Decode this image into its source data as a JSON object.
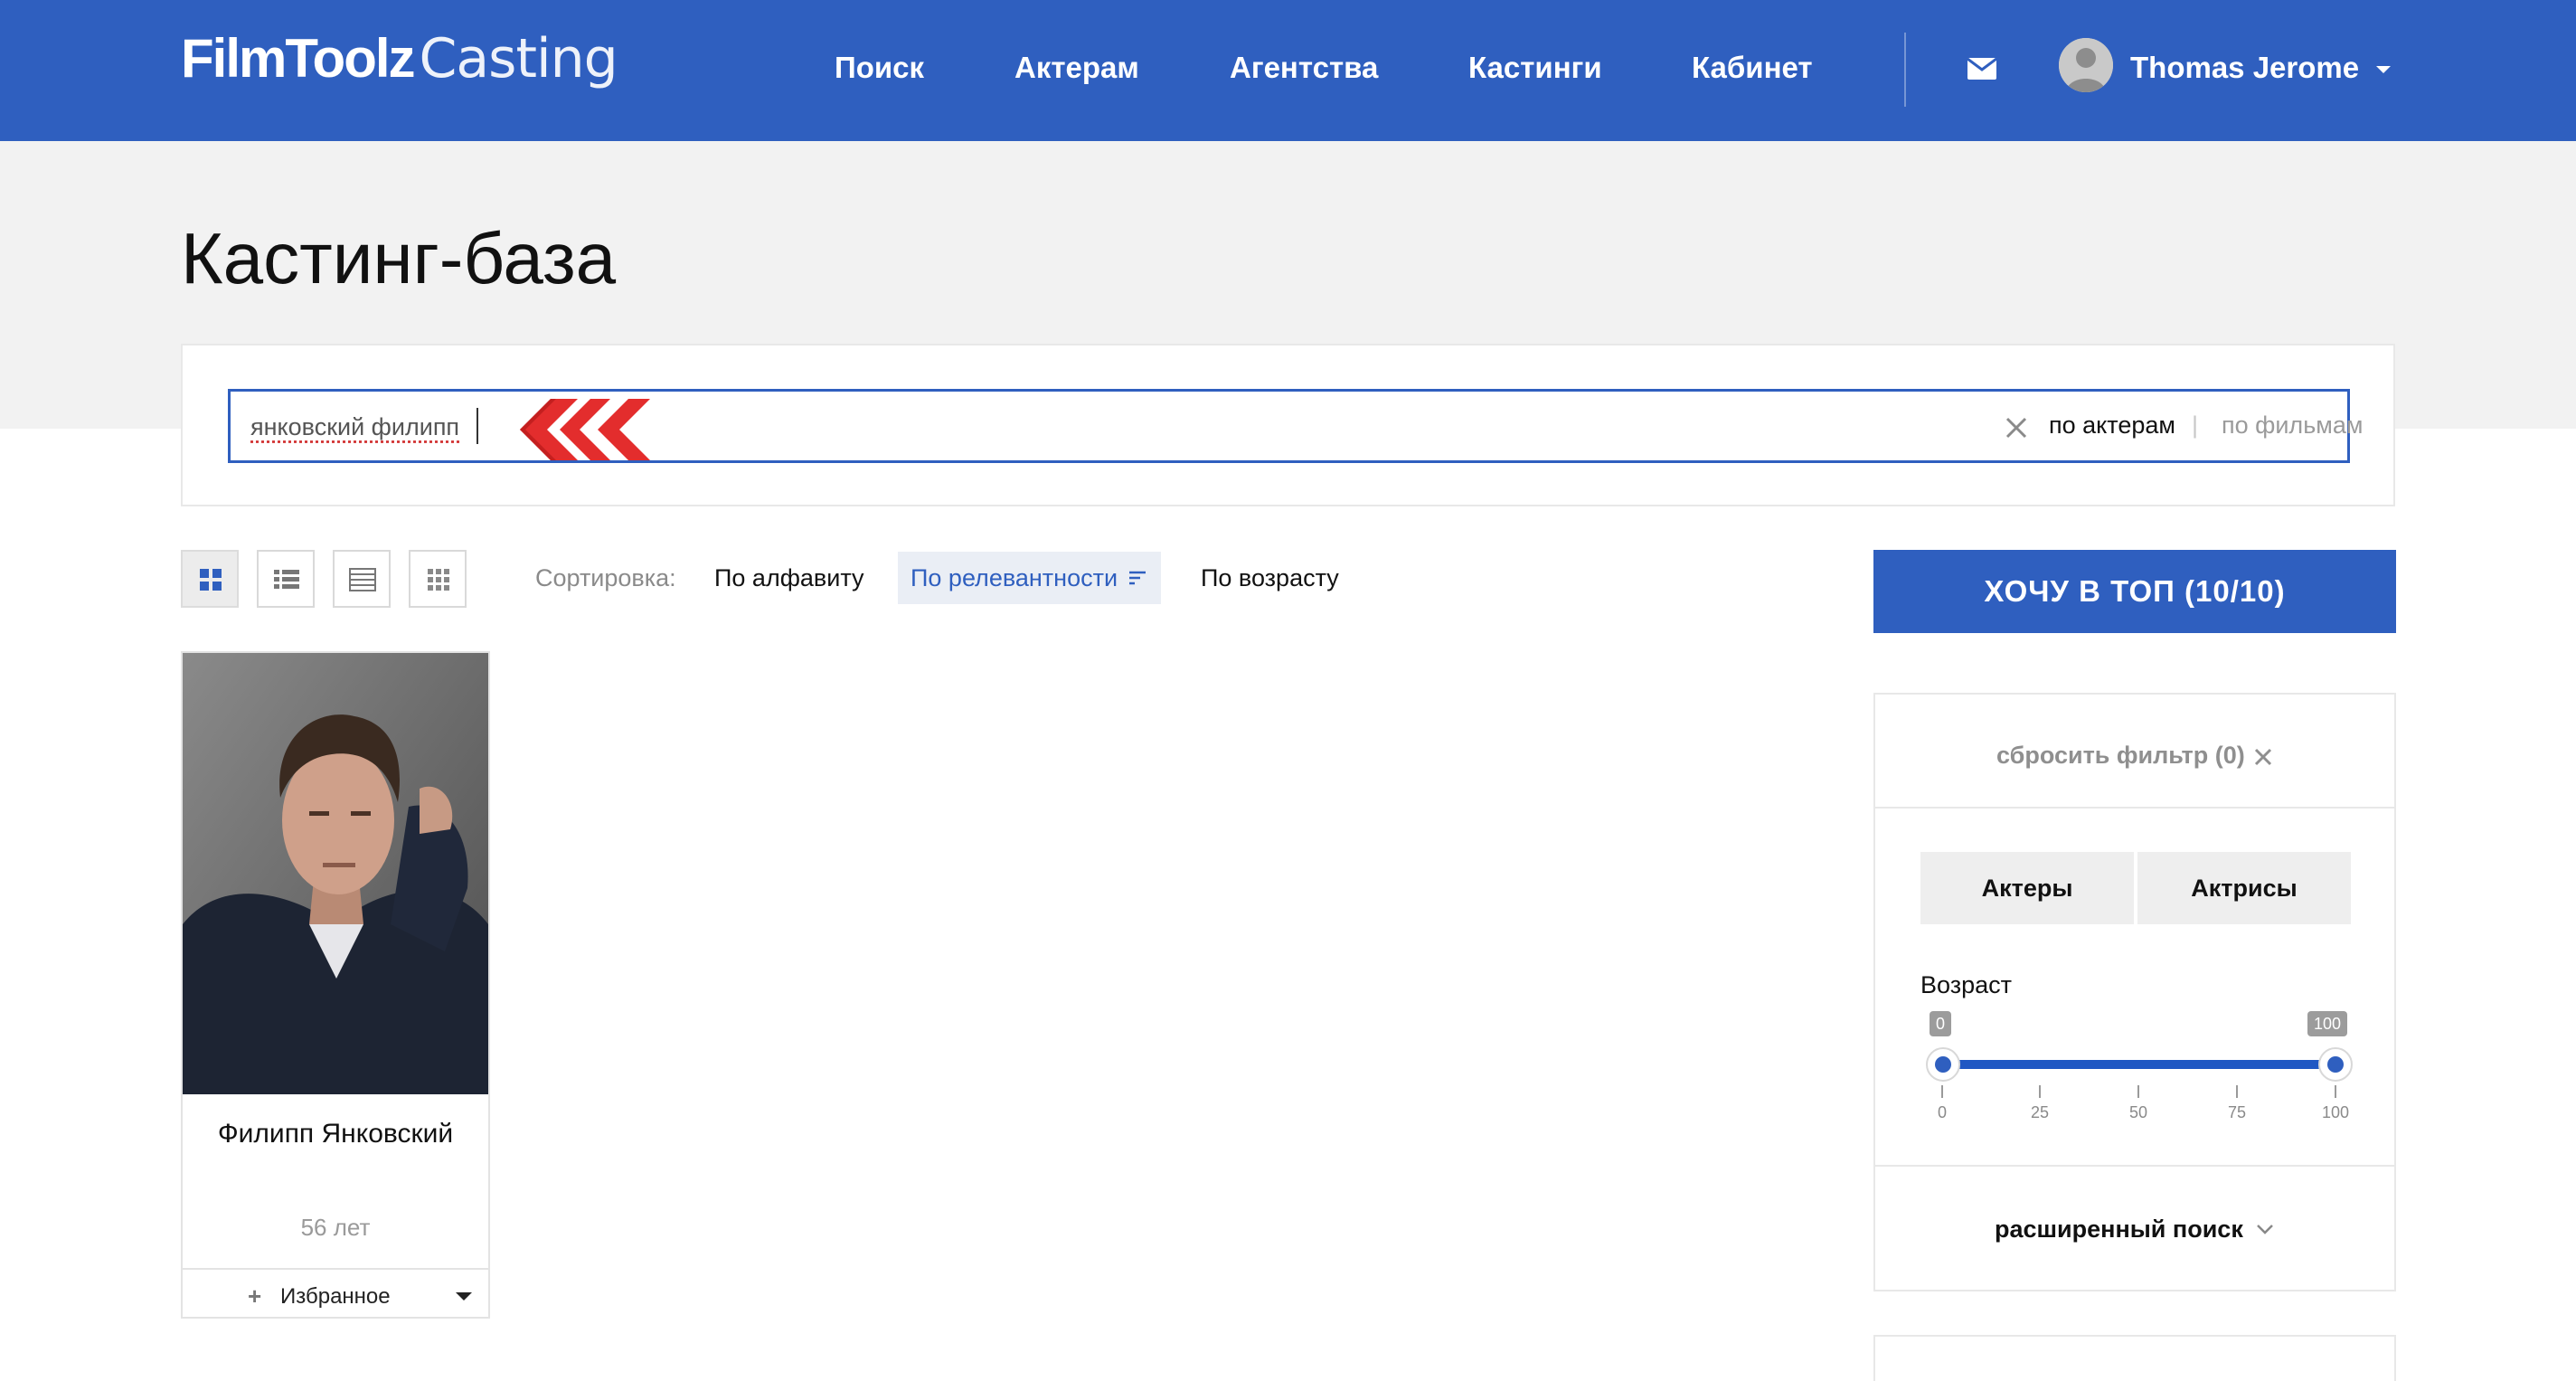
{
  "header": {
    "logo_strong": "FilmToolz",
    "logo_light": "Casting",
    "nav": [
      "Поиск",
      "Актерам",
      "Агентства",
      "Кастинги",
      "Кабинет"
    ],
    "mail_icon": "envelope-icon",
    "user_name": "Thomas Jerome"
  },
  "page": {
    "title": "Кастинг-база"
  },
  "search": {
    "value": "янковский филипп",
    "mode_actors": "по актерам",
    "mode_separator": "|",
    "mode_films": "по фильмам"
  },
  "toolbar": {
    "view_icons": [
      "grid-large-icon",
      "list-icon",
      "table-icon",
      "grid-small-icon"
    ],
    "sort_label": "Сортировка:",
    "sort_options": [
      "По алфавиту",
      "По релевантности",
      "По возрасту"
    ],
    "sort_active": "По релевантности"
  },
  "results": [
    {
      "name": "Филипп Янковский",
      "age": "56 лет",
      "favorite_label": "Избранное"
    }
  ],
  "sidebar": {
    "top_button": "ХОЧУ В ТОП (10/10)",
    "reset_filter": "сбросить фильтр (0)",
    "gender": [
      "Актеры",
      "Актрисы"
    ],
    "age_label": "Возраст",
    "age_min": "0",
    "age_max": "100",
    "age_ticks": [
      "0",
      "25",
      "50",
      "75",
      "100"
    ],
    "advanced_search": "расширенный поиск"
  },
  "colors": {
    "brand_blue": "#2f5fbf",
    "accent_red": "#e32d2d"
  }
}
